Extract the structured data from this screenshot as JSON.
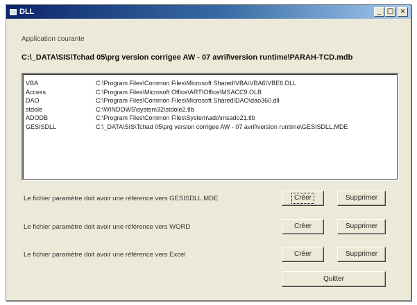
{
  "window": {
    "title": "DLL",
    "minimize_glyph": "_",
    "maximize_glyph": "□",
    "close_glyph": "×"
  },
  "app": {
    "label": "Application courante",
    "path": "C:\\_DATA\\SIS\\Tchad 05\\prg version corrigee AW - 07 avril\\version runtime\\PARAH-TCD.mdb"
  },
  "references": [
    {
      "name": "VBA",
      "path": "C:\\Program Files\\Common Files\\Microsoft Shared\\VBA\\VBA6\\VBE6.DLL"
    },
    {
      "name": "Access",
      "path": "C:\\Program Files\\Microsoft Office\\ART\\Office\\MSACC9.OLB"
    },
    {
      "name": "DAO",
      "path": "C:\\Program Files\\Common Files\\Microsoft Shared\\DAO\\dao360.dll"
    },
    {
      "name": "stdole",
      "path": "C:\\WINDOWS\\system32\\stdole2.tlb"
    },
    {
      "name": "ADODB",
      "path": "C:\\Program Files\\Common Files\\System\\ado\\msado21.tlb"
    },
    {
      "name": "GESISDLL",
      "path": "C:\\_DATA\\SIS\\Tchad 05\\prg version corrigee AW - 07 avril\\version runtime\\GESISDLL.MDE"
    }
  ],
  "actions": [
    {
      "text": "Le fichier paramètre doit avoir une référence vers GESISDLL.MDE",
      "create": "Créer",
      "delete": "Supprimer"
    },
    {
      "text": "Le fichier paramètre doit avoir une référence vers WORD",
      "create": "Créer",
      "delete": "Supprimer"
    },
    {
      "text": "Le fichier paramètre doit avoir une référence vers Excel",
      "create": "Créer",
      "delete": "Supprimer"
    }
  ],
  "quit_label": "Quitter"
}
